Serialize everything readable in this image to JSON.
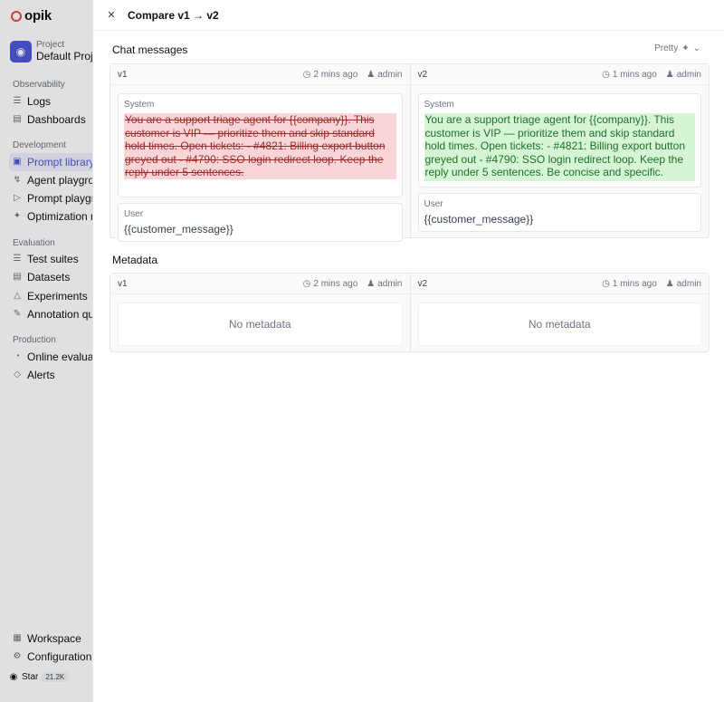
{
  "sidebar": {
    "logo": "opik",
    "project_label": "Project",
    "project_name": "Default Project",
    "sections": [
      {
        "title": "Observability",
        "items": [
          "Logs",
          "Dashboards"
        ]
      },
      {
        "title": "Development",
        "items": [
          "Prompt library",
          "Agent playground",
          "Prompt playground",
          "Optimization runs"
        ]
      },
      {
        "title": "Evaluation",
        "items": [
          "Test suites",
          "Datasets",
          "Experiments",
          "Annotation queues"
        ]
      },
      {
        "title": "Production",
        "items": [
          "Online evaluation",
          "Alerts"
        ]
      }
    ],
    "bottom": [
      "Workspace",
      "Configuration"
    ],
    "star_label": "Star",
    "star_count": "21.2K"
  },
  "panel": {
    "title": "Compare v1 → v2",
    "chat_section": "Chat messages",
    "format": "Pretty",
    "metadata_section": "Metadata",
    "left": {
      "version": "v1",
      "time": "2 mins ago",
      "user": "admin"
    },
    "right": {
      "version": "v2",
      "time": "1 mins ago",
      "user": "admin"
    },
    "system_label": "System",
    "user_label": "User",
    "v1_system": "You are a support triage agent for {{company}}. This customer is VIP — prioritize them and skip standard hold times. Open tickets: - #4821: Billing export button greyed out - #4790: SSO login redirect loop. Keep the reply under 5 sentences.",
    "v2_system": "You are a support triage agent for {{company}}. This customer is VIP — prioritize them and skip standard hold times. Open tickets: - #4821: Billing export button greyed out - #4790: SSO login redirect loop. Keep the reply under 5 sentences. Be concise and specific.",
    "user_message": "{{customer_message}}",
    "no_metadata": "No metadata"
  }
}
